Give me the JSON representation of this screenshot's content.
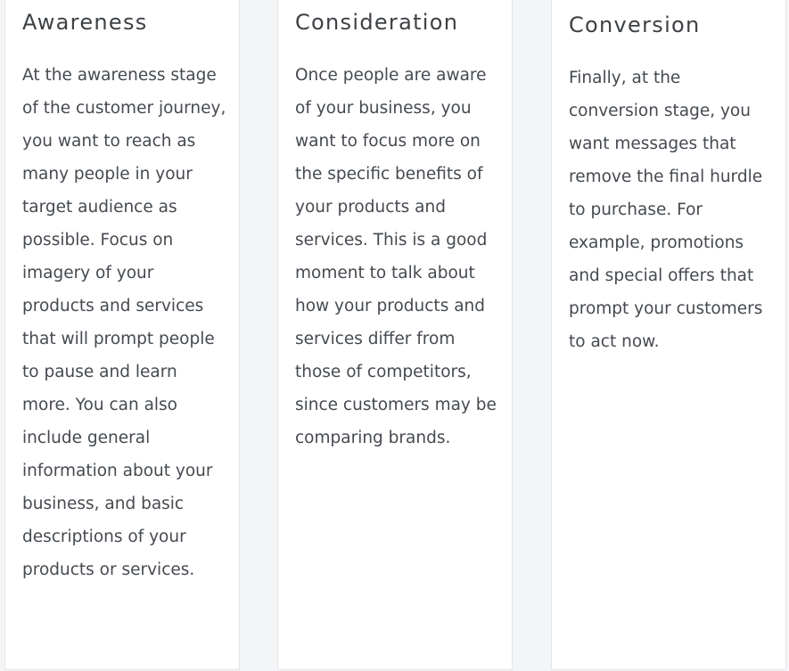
{
  "cards": [
    {
      "title": "Awareness",
      "body": "At the awareness stage of the customer journey, you want to reach as many people in your target audience as possible. Focus on imagery of your products and services that will prompt people to pause and learn more. You can also include general information about your business, and basic descriptions of your products or services."
    },
    {
      "title": "Consideration",
      "body": "Once people are aware of your business, you want to focus more on the specific benefits of your products and services. This is a good moment to talk about how your products and services differ from those of competitors, since customers may be comparing brands."
    },
    {
      "title": "Conversion",
      "body": "Finally, at the conversion stage, you want messages that remove the final hurdle to purchase. For example, promotions and special offers that prompt your customers to act now."
    }
  ]
}
